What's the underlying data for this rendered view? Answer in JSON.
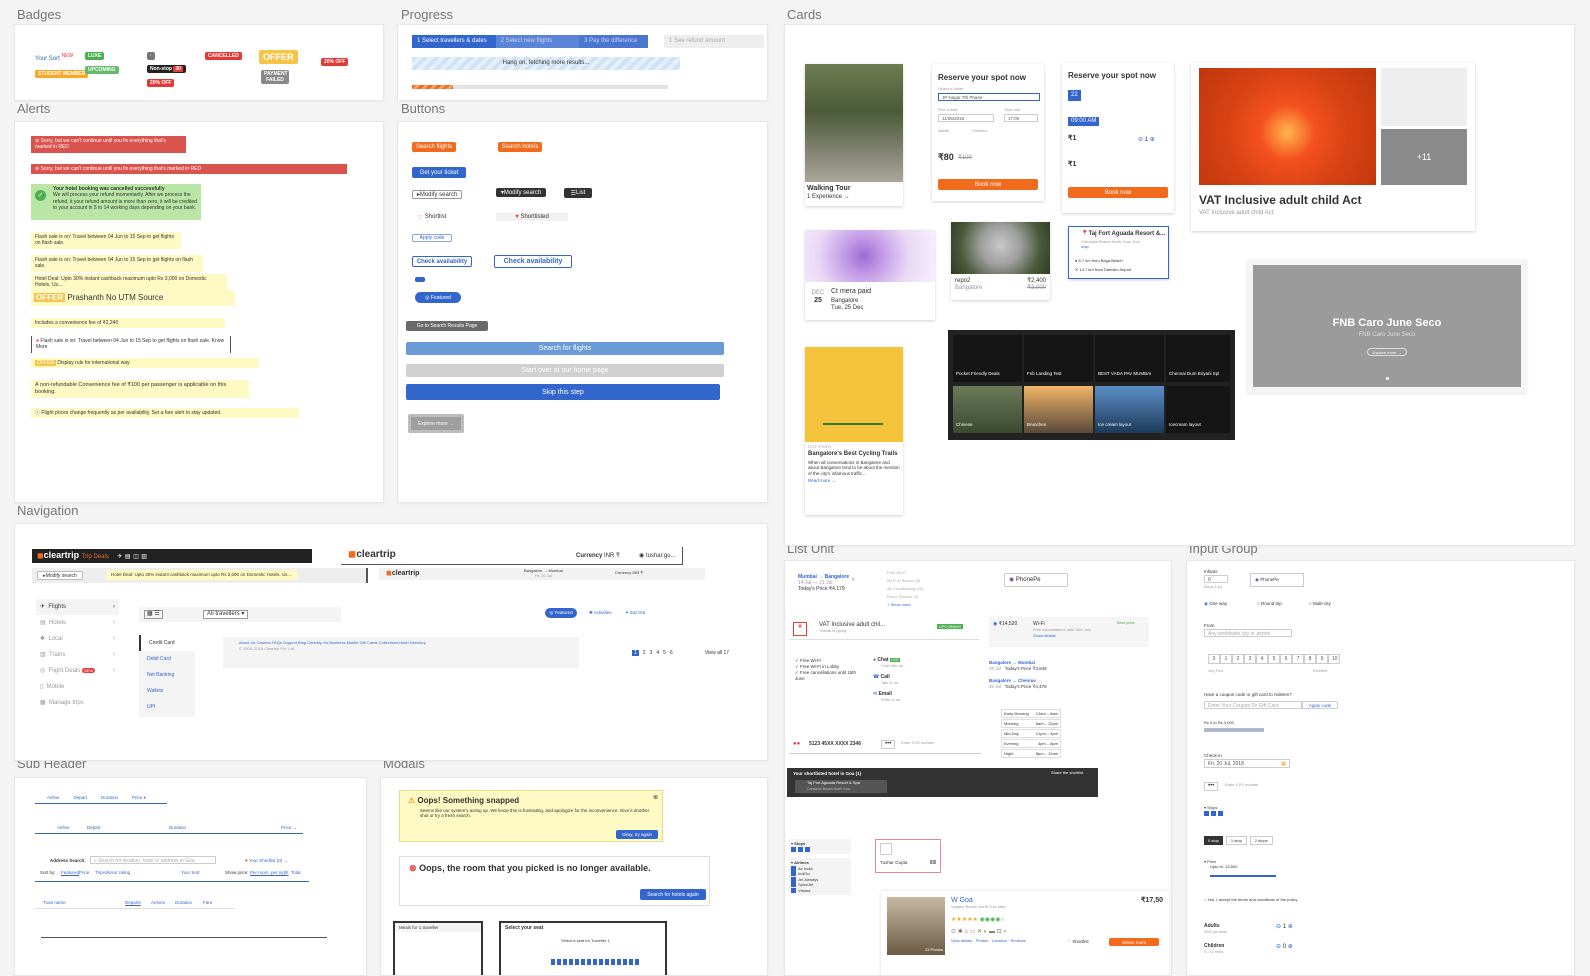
{
  "sections": {
    "badges": "Badges",
    "progress": "Progress",
    "cards": "Cards",
    "alerts": "Alerts",
    "buttons": "Buttons",
    "navigation": "Navigation",
    "list_unit": "List Unit",
    "input_group": "Input Group",
    "sub_header": "Sub Header",
    "modals": "Modals"
  },
  "badges": {
    "your_sort": "Your Sort",
    "new": "NEW",
    "student_member": "STUDENT MEMBER",
    "luxe": "LUXE",
    "upcoming": "UPCOMING",
    "nonstop": "Non-stop",
    "cancelled": "CANCELLED",
    "offer": "OFFER",
    "payment_failed": "PAYMENT FAILED",
    "red_small": "20% OFF"
  },
  "progress": {
    "step1": "1  Select travellers & dates",
    "step2": "2  Select new flights",
    "step3": "3  Pay the difference",
    "step_alt": "1  See refund amount",
    "loading": "Hang on, fetching more results..."
  },
  "alerts": {
    "a1": "Sorry, but we can't continue until you fix everything that's marked in RED",
    "a2": "Sorry, but we can't continue until you fix everything that's marked in RED",
    "success_title": "Your hotel booking was cancelled successfully",
    "success_body": "We will process your refund momentarily. After we process the refund, it your refund amount is more than zero, it will be credited to your account in 5 to 14 working days depending on your bank.",
    "flash1": "Flash sale is on: Travel between 04 Jun to 15 Sep to get flights on flash sale.",
    "flash2": "Flash sale is on: Travel between 04 Jun to 15 Sep to get flights on flash sale.",
    "hotel_deal": "Hotel Deal: Upto 30% instant cashback maximum upto Rs 3,000 on Domestic Hotels. Us...",
    "offer_tag": "OFFER",
    "offer_text": "Prashanth No UTM Source",
    "fee": "Includes a convenience fee of ₹2,240",
    "flash3": "Flash sale is on: Travel between 04 Jun to 15 Sep to get flights on flash sale. Know More",
    "display_rule": "Display rule for international way",
    "nonrefund": "A non-refundable Convenience fee of ₹100 per passenger is applicable on this booking.",
    "price_change": "Flight prices change frequently as per availability. Set a fare alert to stay updated."
  },
  "buttons": {
    "search_flights": "Search flights",
    "search_hotels": "Search hotels",
    "get_ticket": "Get your ticket",
    "modify_search": "Modify search",
    "modify_search_dark": "Modify search",
    "list": "List",
    "shortlist": "Shortlist",
    "shortlisted": "Shortlisted",
    "apply_code": "Apply code",
    "check1": "Check availability",
    "check2": "Check availability",
    "featured": "Featured",
    "go_results": "Go to Search Results Page",
    "search_for_flights": "Search for flights",
    "start_over": "Start over at our home page",
    "skip": "Skip this step",
    "explore_more": "Explore more →"
  },
  "cards": {
    "walking_tour": "Walking Tour",
    "walking_sub": "1 Experience →",
    "reserve1": "Reserve your spot now",
    "select_outlet": "Select a outlet",
    "outlet_value": "JP Nagar 7th Phase",
    "pick_date": "Pick a date",
    "date_value": "11/06/2018",
    "time_slot": "Time slot",
    "time_value": "17:00",
    "adults": "Adults",
    "children": "Children",
    "price1": "₹80",
    "price1_old": "₹100",
    "book_now": "Book now",
    "reserve2": "Reserve your spot now",
    "day": "22",
    "time_chip": "09:00 AM",
    "price2a": "₹1",
    "price2b": "₹1",
    "qty": "1",
    "vat_title": "VAT Inclusive adult child Act",
    "vat_sub": "VAT Inclusive adult child Act",
    "plus_more": "+11",
    "event_title": "Ct mera paid",
    "event_place": "Bangalore",
    "event_date": "Tue, 25 Dec",
    "event_month": "DEC",
    "event_day": "25",
    "koala_title": "repo2",
    "koala_place": "Bangalore",
    "koala_price": "₹2,400",
    "koala_old": "₹3,000",
    "hotel_title": "Taj Fort Aguada Resort &...",
    "hotel_addr": "Candolim Beach North Goa, Goa",
    "hotel_map": "map",
    "hotel_d1": "8.7 km from Baga Beach",
    "hotel_d2": "14.7 km from Dabolim Airport",
    "fnb_title": "FNB Caro June Seco",
    "fnb_sub": "FNB Caro June Seco",
    "fnb_btn": "Explore more →",
    "cycling_kicker": "CITY STORY",
    "cycling_title": "Bangalore's Best Cycling Trails",
    "cycling_body": "When all conversations in Bangalore and about Bangalore tend to be about the mention of the city's infamous traffic...",
    "read_more": "Read more →",
    "grid": [
      "Pocket Friendly Deals",
      "Fnb Landing Test",
      "BEST VADA PAV MUMBAI",
      "Chennai Dum Biryani Spl",
      "Chinese",
      "Brunches",
      "Ice cream layout",
      "Icecream layout"
    ],
    "grid_sub": "1 Experience"
  },
  "navigation": {
    "logo": "cleartrip",
    "trip_deals": "Trip Deals",
    "currency": "Currency",
    "inr": "INR ₹",
    "user": "tushar.gu...",
    "modify_search": "Modify search",
    "hotel_deal": "Hotel Deal: Upto 30% instant cashback maximum upto Rs 3,000 on Domestic Hotels. Us...",
    "route": "Bangalore → Mumbai",
    "route_sub": "Fri, 20 Jul",
    "side": [
      "Flights",
      "Hotels",
      "Local",
      "Trains",
      "Flight Deals",
      "Mobile",
      "Manage trips"
    ],
    "new_tag": "NEW",
    "payment": [
      "Credit Card",
      "Debit Card",
      "Net Banking",
      "Wallets",
      "UPI"
    ],
    "all_travellers": "All travellers ▾",
    "footer_links": "About Us  Careers  FAQs  Support  Blog  Cleartrip for Business  Mobile  Gift Cards  Collections  Hotel Directory",
    "footer_copy": "© 2006–2018 Cleartrip Pvt. Ltd.",
    "tab_featured": "Featured",
    "tab_activities": "Activities",
    "tab_eat": "Eat Out",
    "pages": [
      "1",
      "2",
      "3",
      "4",
      "5",
      "6"
    ],
    "view_all": "View all 17"
  },
  "list_unit": {
    "route": "Mumbai → Bangalore",
    "route_dates": "14 Jul — 21 Jul",
    "route_price": "Today's Price ₹4,179",
    "amenities_more": "+ Show more",
    "amen": [
      "Free Wi-Fi",
      "Wi-Fi in Rooms (3)",
      "Air Conditioning (33)",
      "Room Service (4)"
    ],
    "phonepe": "PhonePe",
    "vat_title": "VAT Inclusive adult chil...",
    "vat_by": "Tushar is going",
    "upcoming": "UPCOMING",
    "fare": "₹14,520",
    "wifi": "Wi-Fi",
    "free_cancel": "Free cancellations until 18th July",
    "show_details": "Show details",
    "best_price": "Best price",
    "features": [
      "Free Wi-Fi",
      "Free Wi-Fi in Lobby",
      "Free cancellations until 15th June"
    ],
    "chat": "Chat",
    "chat_sub": "Chat with us",
    "live": "LIVE",
    "call": "Call",
    "call_sub": "Talk to us",
    "email": "Email",
    "email_sub": "Write to us",
    "r1": "Bangalore → Mumbai",
    "r1d": "20 Jul",
    "r1p": "Today's Price ₹3,849",
    "r2": "Bangalore → Chennai",
    "r2d": "20 Jul",
    "r2p": "Today's Price ₹4,479",
    "times": [
      [
        "Early Morning",
        "12am – 8am"
      ],
      [
        "Morning",
        "8am – 12pm"
      ],
      [
        "Mid-Day",
        "12pm – 4pm"
      ],
      [
        "Evening",
        "4pm – 8pm"
      ],
      [
        "Night",
        "8pm – 12am"
      ]
    ],
    "card_no": "5123 45XX XXXX 2346",
    "cvv": "Enter CVV number",
    "shortlist_bar": "Your shortlisted hotel in Goa (1)",
    "share": "Share the shortlist",
    "short_hotel": "Taj Fort Aguada Resort & Spa",
    "short_addr": "Candolim Beach North Goa",
    "stops": "Stops",
    "airlines": "Airlines",
    "airline_list": [
      "Air India",
      "IndiGo",
      "Jet Airways",
      "SpiceJet",
      "Vistara"
    ],
    "user": "Tushar Gupta",
    "w_name": "W Goa",
    "w_addr": "Vagator Beach North Goa Map",
    "w_price": "₹17,50",
    "w_photos": "23 Photos",
    "w_details": "View details · Photos · Location · Reviews",
    "w_shortlist": "Shortlist",
    "w_select": "Select room"
  },
  "input_group": {
    "infants": "Infants",
    "infants_val": "0",
    "infants_sub": "Below 2 yrs",
    "phonepe": "PhonePe",
    "one_way": "One way",
    "round_trip": "Round trip",
    "multi_city": "Multi-city",
    "from": "From",
    "from_ph": "Any worldwide city or airport",
    "scale": [
      "0",
      "1",
      "2",
      "3",
      "4",
      "5",
      "6",
      "7",
      "8",
      "9",
      "10"
    ],
    "very_poor": "Very Poor",
    "excellent": "Excellent",
    "coupon_q": "Have a coupon code or gift card to redeem?",
    "coupon_ph": "Enter Your Coupon Or Gift Card",
    "apply": "Apply code",
    "range": "Rs 0 to Rs 3,000",
    "checkin": "Check-in",
    "checkin_val": "Fri, 20 Jul, 2018",
    "cvv": "Enter CVV number",
    "stops": "Stops",
    "seg": [
      "0 stop",
      "1 stop",
      "2 stops"
    ],
    "price": "Price",
    "price_sub": "Upto rs. 13,800",
    "terms": "Yes, I accept the terms and conditions of the policy",
    "adults": "Adults",
    "adults_sub": "₹200 per head",
    "children": "Children",
    "children_sub": "5 – 11 Years",
    "qty1": "1",
    "qty0": "0"
  },
  "sub_header": {
    "t1": [
      "Airline",
      "Depart",
      "Duration",
      "Price ▾"
    ],
    "t2": [
      "Airline",
      "Depart",
      "Duration",
      "Price →"
    ],
    "addr_label": "Address Search:",
    "addr_ph": "Search for location, hotel or address in Goa",
    "shortlist": "Your Shortlist (0) →",
    "sort_by": "Sort by:",
    "sort_items": [
      "Featured",
      "Price",
      "TripAdvisor rating",
      "Your Sort"
    ],
    "show_price": "Show price:",
    "per_room": "Per room, per night",
    "total": "Total",
    "t3": [
      "Train name",
      "Departs",
      "Arrives",
      "Duration",
      "Fare"
    ]
  },
  "modals": {
    "oops_title": "Oops! Something snapped",
    "oops_body": "Seems like our system's acting up. We know this is frustrating, and apologize for the inconvenience. Give it another shot or try a fresh search.",
    "oops_btn": "Okay, try again",
    "room_title": "Oops, the room that you picked is no longer available.",
    "room_btn": "Search for hotels again",
    "meals": "Meals for 1 traveller",
    "seat": "Select your seat",
    "seat_sub": "Select a seat for Traveller 1"
  },
  "colors": {
    "orange": "#f26b1d",
    "blue": "#3366cc",
    "red": "#d9534f",
    "green": "#4caf50",
    "yellow": "#fff9c4"
  }
}
